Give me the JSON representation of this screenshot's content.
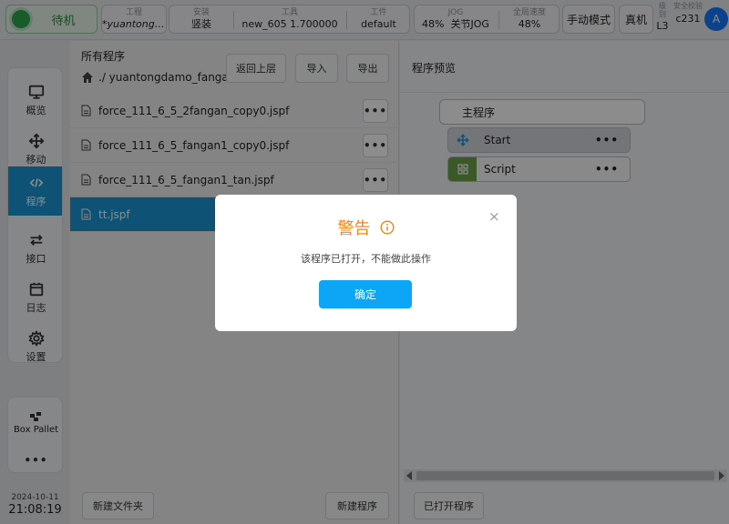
{
  "topbar": {
    "status": "待机",
    "project_label": "工程",
    "project_value": "*yuantongdamo_fangan",
    "install_label": "安装",
    "install_value": "竖装",
    "tool_label": "工具",
    "tool_value": "new_605   1.700000",
    "workpiece_label": "工件",
    "workpiece_value": "default",
    "jog_label": "JOG",
    "jog_value": "48%",
    "joint_jog_label": "关节JOG",
    "speed_label": "全局速度",
    "speed_value": "48%",
    "manual_mode": "手动模式",
    "real_machine": "真机",
    "level_label": "级\n别",
    "level_value": "L3",
    "checksum_label": "安全校验",
    "checksum_value": "c231",
    "avatar": "A"
  },
  "nav": {
    "items": [
      {
        "label": "概览",
        "icon": "monitor-icon"
      },
      {
        "label": "移动",
        "icon": "move-icon"
      },
      {
        "label": "程序",
        "icon": "code-icon"
      },
      {
        "label": "接口",
        "icon": "swap-icon"
      },
      {
        "label": "日志",
        "icon": "calendar-icon"
      },
      {
        "label": "设置",
        "icon": "gear-icon"
      }
    ],
    "box_pallet": "Box Pallet",
    "more": "•••"
  },
  "clock": {
    "date": "2024-10-11",
    "time": "21:08:19"
  },
  "files": {
    "title": "所有程序",
    "path": "./ yuantongdamo_fangan",
    "back_btn": "返回上层",
    "import_btn": "导入",
    "export_btn": "导出",
    "items": [
      {
        "name": "force_111_6_5_2fangan_copy0.jspf"
      },
      {
        "name": "force_111_6_5_fangan1_copy0.jspf"
      },
      {
        "name": "force_111_6_5_fangan1_tan.jspf"
      },
      {
        "name": "tt.jspf"
      }
    ],
    "more_label": "•••",
    "new_folder_btn": "新建文件夹",
    "new_program_btn": "新建程序"
  },
  "preview": {
    "title": "程序预览",
    "main_program": "主程序",
    "nodes": [
      {
        "label": "Start",
        "icon": "move-icon",
        "color": "#d3d6da",
        "icon_color": "#1a98d5"
      },
      {
        "label": "Script",
        "icon": "grid-icon",
        "color": "#fafafa",
        "icon_bg": "#6ba04a"
      }
    ],
    "node_more": "•••",
    "opened_btn": "已打开程序"
  },
  "modal": {
    "title": "警告",
    "close": "×",
    "message": "该程序已打开，不能做此操作",
    "ok": "确定"
  }
}
